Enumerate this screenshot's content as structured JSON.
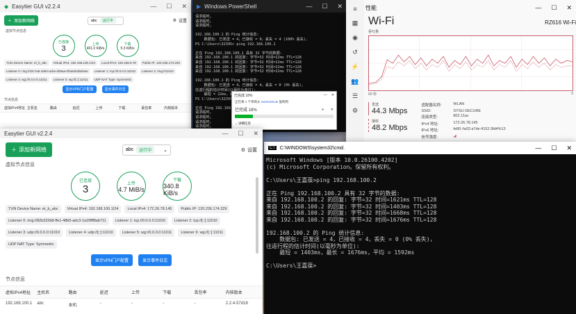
{
  "easytier_back": {
    "title": "Easytier GUI v2.2.4",
    "add_network": "添加新网络",
    "network": "abc",
    "status": "运行中",
    "settings": "设置",
    "section_label": "虚拟节点信息",
    "connected_label": "已连接",
    "connected_value": "3",
    "up_label": "上传",
    "up_value": "401.0 KiB/s",
    "down_label": "下载",
    "down_value": "5.3 KiB/s",
    "tags": [
      "TUN Device Name: et_b_abc",
      "Virtual IPv4: 192.168.100.1/24",
      "Local IPv4: 192.168.6.78",
      "Public IP: 120.236.173.229",
      "Listener 0: ring://32c7a6-4de0-acbe-d05aa-0f4a5d4d5d4ee",
      "Listener 1: tcp://0.0.0.0:11010",
      "Listener 2: ring://11010",
      "Listener 4: wg://0.0.0.0:11011",
      "Listener 5: wg://[::]:11011",
      "UDP NAT Type: Symmetric"
    ],
    "show_vpn": "显示VPN门户配置",
    "show_events": "显示事件日志",
    "peers_title": "节点信息",
    "peer_cols": [
      "虚拟IPv4地址",
      "主机名",
      "路由",
      "延迟",
      "上传",
      "下载",
      "丢包率",
      "内核版本"
    ]
  },
  "easytier": {
    "title": "Easytier GUI v2.2.4",
    "add_network": "添加新网络",
    "network": "abc",
    "status": "运行中",
    "settings": "设置",
    "section_label": "虚拟节点信息",
    "connected_label": "已连接",
    "connected_value": "3",
    "up_label": "上传",
    "up_value": "4.7 MiB/s",
    "down_label": "下载",
    "down_value": "340.8 KiB/s",
    "tags": [
      "TUN Device Name: et_b_abc",
      "Virtual IPv4: 192.168.100.1/24",
      "Local IPv4: 172.26.78.145",
      "Public IP: 120.236.174.229",
      "Listener 0: ring://82b322b8-ffe1-48b5-adc3-1a1f8ff8ab711",
      "Listener 1: tcp://0.0.0.0:11010",
      "Listener 2: tcp://[::]:11010",
      "Listener 3: udp://0.0.0.0:11010",
      "Listener 4: udp://[::]:11010",
      "Listener 5: wg://0.0.0.0:11011",
      "Listener 6: wg://[::]:11011",
      "UDP NAT Type: Symmetric"
    ],
    "show_vpn": "显示VPN门户配置",
    "show_events": "显示事件日志",
    "peers_title": "节点信息",
    "peer_cols": [
      "虚拟IPv4地址",
      "主机名",
      "路由",
      "延迟",
      "上传",
      "下载",
      "丢包率",
      "内核版本"
    ],
    "peer_row": [
      "192.168.100.1",
      "abc",
      "本机",
      "-",
      "-",
      "-",
      "-",
      "2.2.4-57d18"
    ]
  },
  "powershell": {
    "title": "Windows PowerShell",
    "lines": "请求超时。\n请求超时。\n请求超时。\n\n192.168.100.1 的 Ping 统计信息:\n    数据包: 已发送 = 4，已接收 = 0，丢失 = 4 (100% 丢失)，\nPS C:\\Users\\32395> ping 192.168.100.1\n\n正在 Ping 192.168.100.1 具有 32 字节的数据:\n来自 192.168.100.1 的回复: 字节=32 时间=22ms TTL=128\n来自 192.168.100.1 的回复: 字节=32 时间=22ms TTL=128\n来自 192.168.100.1 的回复: 字节=32 时间=22ms TTL=128\n来自 192.168.100.1 的回复: 字节=32 时间=22ms TTL=128\n\n192.168.100.1 的 Ping 统计信息:\n    数据包: 已发送 = 4，已接收 = 4，丢失 = 0 (0% 丢失)，\n往返行程的估计时间(以毫秒为单位):\n    最短 = 22ms，最长 = 23ms，平均 = 23ms\nPS C:\\Users\\32395> 192.168.100.1\n\n正在 Ping 192.168.100.1 具有 32\n请求超时。\n请求超时。\n请求超时。\n请求超时。"
  },
  "ping_dialog": {
    "title": "已完成 18%",
    "message_pre": "正在将 1 个项目从",
    "message_link": "SoreUsGuie",
    "message_post": "复制到",
    "percent_text": "已完成 18%",
    "progress": 0.18,
    "details": "详细信息"
  },
  "taskmanager": {
    "title": "性能",
    "heading": "Wi-Fi",
    "adapter": "RZ616 Wi-Fi",
    "graph_label": "吞吐量",
    "graph_left": "60 秒",
    "graph_right": "0",
    "send_label": "发送",
    "send_value": "44.3 Mbps",
    "recv_label": "接收",
    "recv_value": "48.2 Mbps",
    "info": [
      [
        "适配器名称:",
        "WLAN"
      ],
      [
        "SSID:",
        "SYSU-SECURE"
      ],
      [
        "连接类型:",
        "802.11ac"
      ],
      [
        "IPv4 地址:",
        "172.26.78.145"
      ],
      [
        "IPv6 地址:",
        "fe80::fa02:a7de:4152:3fd4%13"
      ],
      [
        "信号强度:",
        ""
      ]
    ],
    "colors": {
      "accent": "#c65c6a"
    }
  },
  "cmd": {
    "title": "C:\\WINDOWS\\system32\\cmd.",
    "lines": "Microsoft Windows [版本 10.0.26100.4202]\n(c) Microsoft Corporation。保留所有权利。\n\nC:\\Users\\王嘉葆>ping 192.168.100.2\n\n正在 Ping 192.168.100.2 具有 32 字节的数据:\n来自 192.168.100.2 的回复: 字节=32 时间=1621ms TTL=128\n来自 192.168.100.2 的回复: 字节=32 时间=1403ms TTL=128\n来自 192.168.100.2 的回复: 字节=32 时间=1668ms TTL=128\n来自 192.168.100.2 的回复: 字节=32 时间=1676ms TTL=128\n\n192.168.100.2 的 Ping 统计信息:\n    数据包: 已发送 = 4，已接收 = 4，丢失 = 0 (0% 丢失)，\n往返行程的估计时间(以毫秒为单位):\n    最短 = 1403ms，最长 = 1676ms，平均 = 1592ms\n\nC:\\Users\\王嘉葆>"
  }
}
